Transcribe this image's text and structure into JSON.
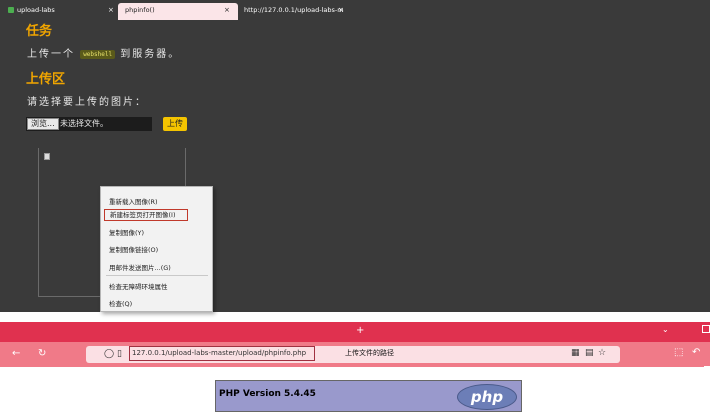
{
  "task": {
    "heading": "任务",
    "text_before": "上传一个",
    "code": "webshell",
    "text_after": "到服务器。"
  },
  "upload": {
    "heading": "上传区",
    "prompt": "请选择要上传的图片：",
    "browse_label": "浏览...",
    "no_file_label": "未选择文件。",
    "submit_label": "上传"
  },
  "context_menu": {
    "items": [
      "重新载入图像(R)",
      "新建标签页打开图像(I)",
      "复制图像(Y)",
      "复制图像链接(O)",
      "用邮件发送图片...(G)",
      "检查无障碍环境属性",
      "检查(Q)"
    ],
    "highlighted_index": 1
  },
  "browser": {
    "tabs": [
      {
        "label": "upload-labs",
        "active": false
      },
      {
        "label": "phpinfo()",
        "active": true
      },
      {
        "label": "http://127.0.0.1/upload-labs-mas",
        "active": false
      }
    ],
    "new_tab": "+",
    "url": "127.0.0.1/upload-labs-master/upload/phpinfo.php",
    "annotation": "上传文件的路径"
  },
  "phpinfo": {
    "version": "PHP Version 5.4.45",
    "logo_text": "php"
  },
  "icons": {
    "back": "arrow-left-icon",
    "reload": "reload-icon",
    "shield": "shield-icon",
    "page": "page-icon",
    "qr": "qr-code-icon",
    "reader": "reader-view-icon",
    "bookmark": "star-icon"
  },
  "colors": {
    "accent_heading": "#f0a500",
    "upload_button": "#f4c400",
    "tab_bar": "#e0314f",
    "nav_bar": "#f07a88",
    "php_banner": "#9999cc"
  }
}
